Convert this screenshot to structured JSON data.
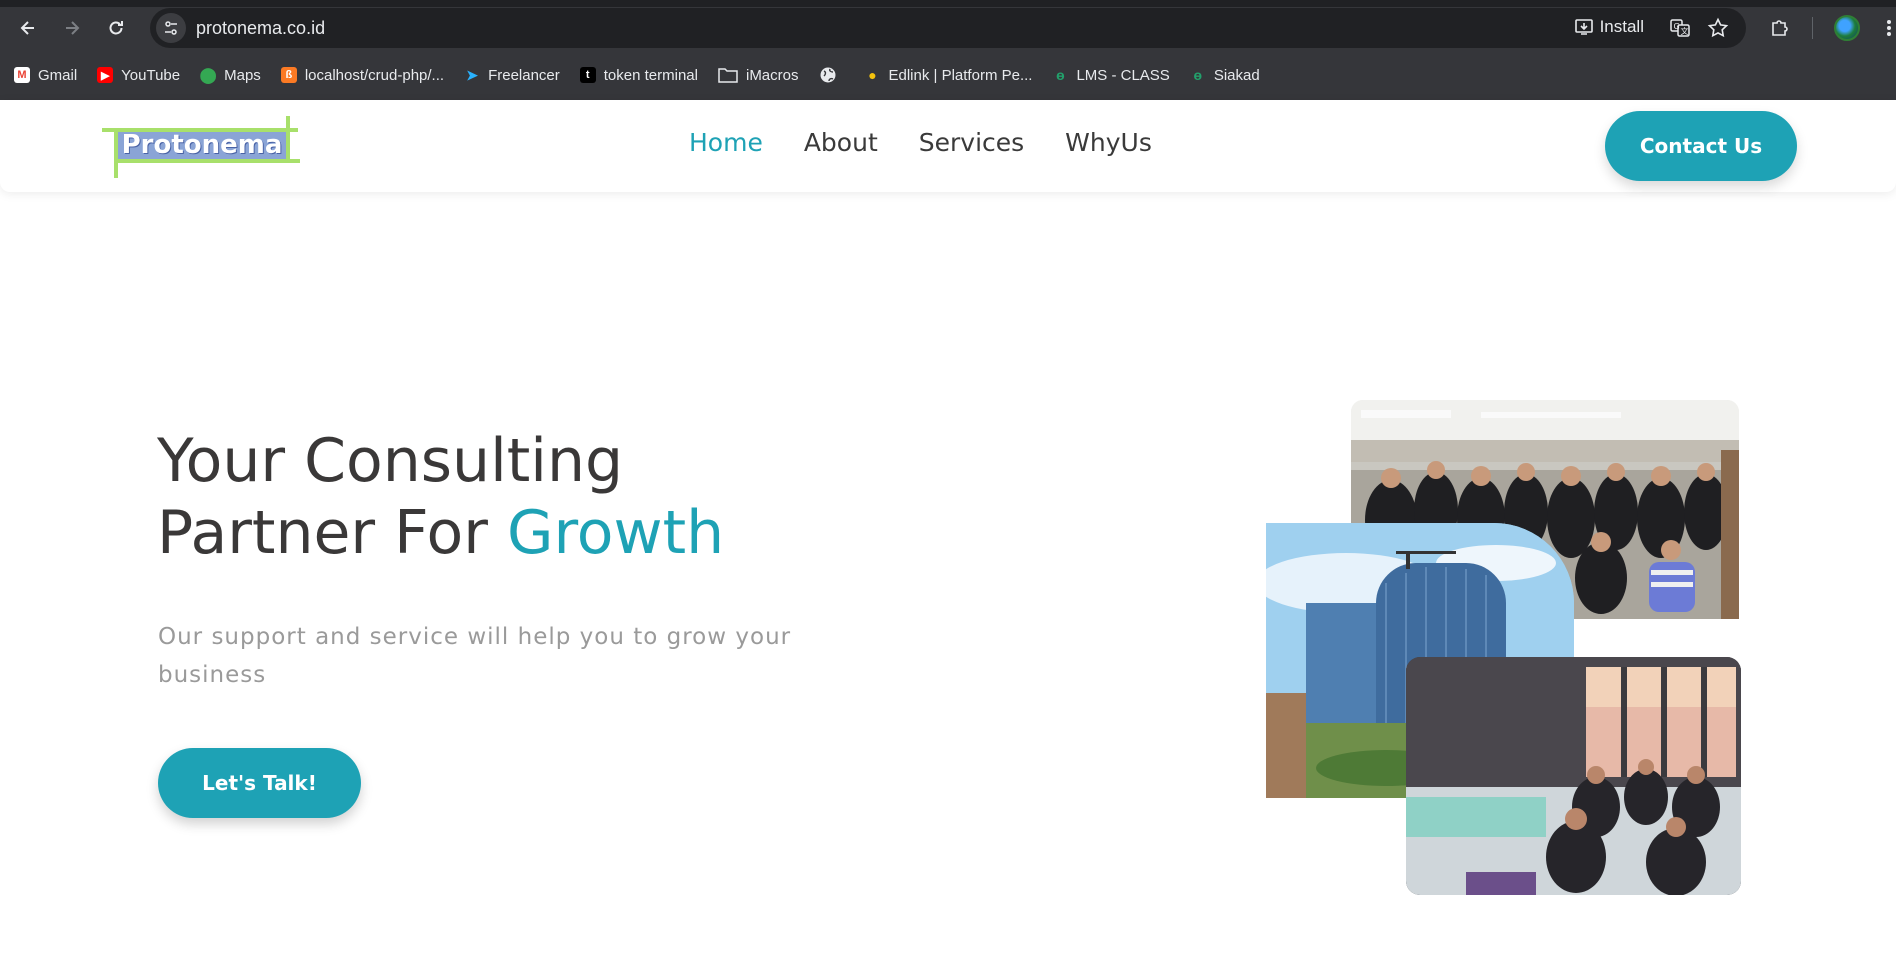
{
  "browser": {
    "url": "protonema.co.id",
    "install_label": "Install",
    "bookmarks": [
      {
        "label": "Gmail",
        "icon": "gmail-icon"
      },
      {
        "label": "YouTube",
        "icon": "youtube-icon"
      },
      {
        "label": "Maps",
        "icon": "maps-icon"
      },
      {
        "label": "localhost/crud-php/...",
        "icon": "xampp-icon"
      },
      {
        "label": "Freelancer",
        "icon": "freelancer-icon"
      },
      {
        "label": "token terminal",
        "icon": "token-terminal-icon"
      },
      {
        "label": "iMacros",
        "icon": "folder-icon"
      },
      {
        "label": "",
        "icon": "globe-icon"
      },
      {
        "label": "Edlink | Platform Pe...",
        "icon": "edlink-icon"
      },
      {
        "label": "LMS - CLASS",
        "icon": "lms-icon"
      },
      {
        "label": "Siakad",
        "icon": "siakad-icon"
      }
    ]
  },
  "site": {
    "logo_text": "Protonema",
    "nav": [
      {
        "label": "Home",
        "active": true
      },
      {
        "label": "About",
        "active": false
      },
      {
        "label": "Services",
        "active": false
      },
      {
        "label": "WhyUs",
        "active": false
      }
    ],
    "contact_label": "Contact Us",
    "hero": {
      "title_line1": "Your Consulting",
      "title_line2_prefix": "Partner For ",
      "title_accent": "Growth",
      "subtitle": "Our support and service will help you to grow your business",
      "cta_label": "Let's Talk!"
    },
    "accent_color": "#1ea2b5",
    "logo_accent_color": "#a8e06b"
  }
}
